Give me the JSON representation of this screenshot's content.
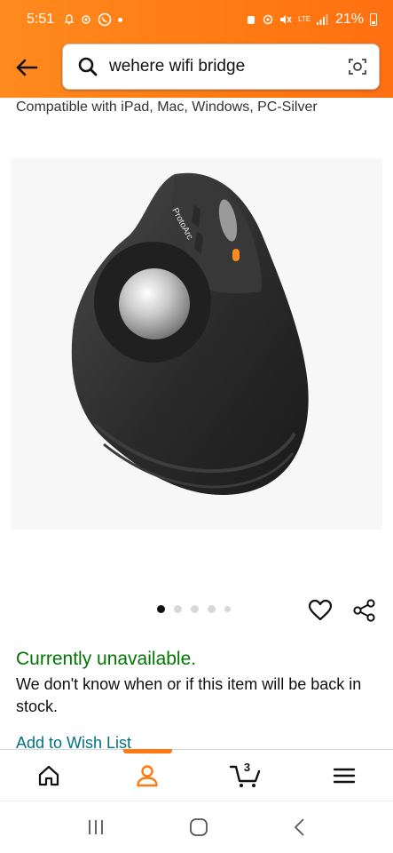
{
  "status_bar": {
    "time": "5:51",
    "network": "LTE",
    "battery": "21%"
  },
  "search": {
    "query": "wehere wifi bridge"
  },
  "product": {
    "title_tail": "Compatible with iPad, Mac, Windows, PC-Silver",
    "brand_on_image": "ProtoArc",
    "image_count": 5,
    "active_image": 1
  },
  "availability": {
    "status": "Currently unavailable.",
    "message": "We don't know when or if this item will be back in stock."
  },
  "wishlist": {
    "label": "Add to Wish List"
  },
  "bottom_nav": {
    "cart_count": "3"
  },
  "colors": {
    "header_orange": "#ff7a12",
    "available_green": "#007600",
    "link_teal": "#007185"
  }
}
